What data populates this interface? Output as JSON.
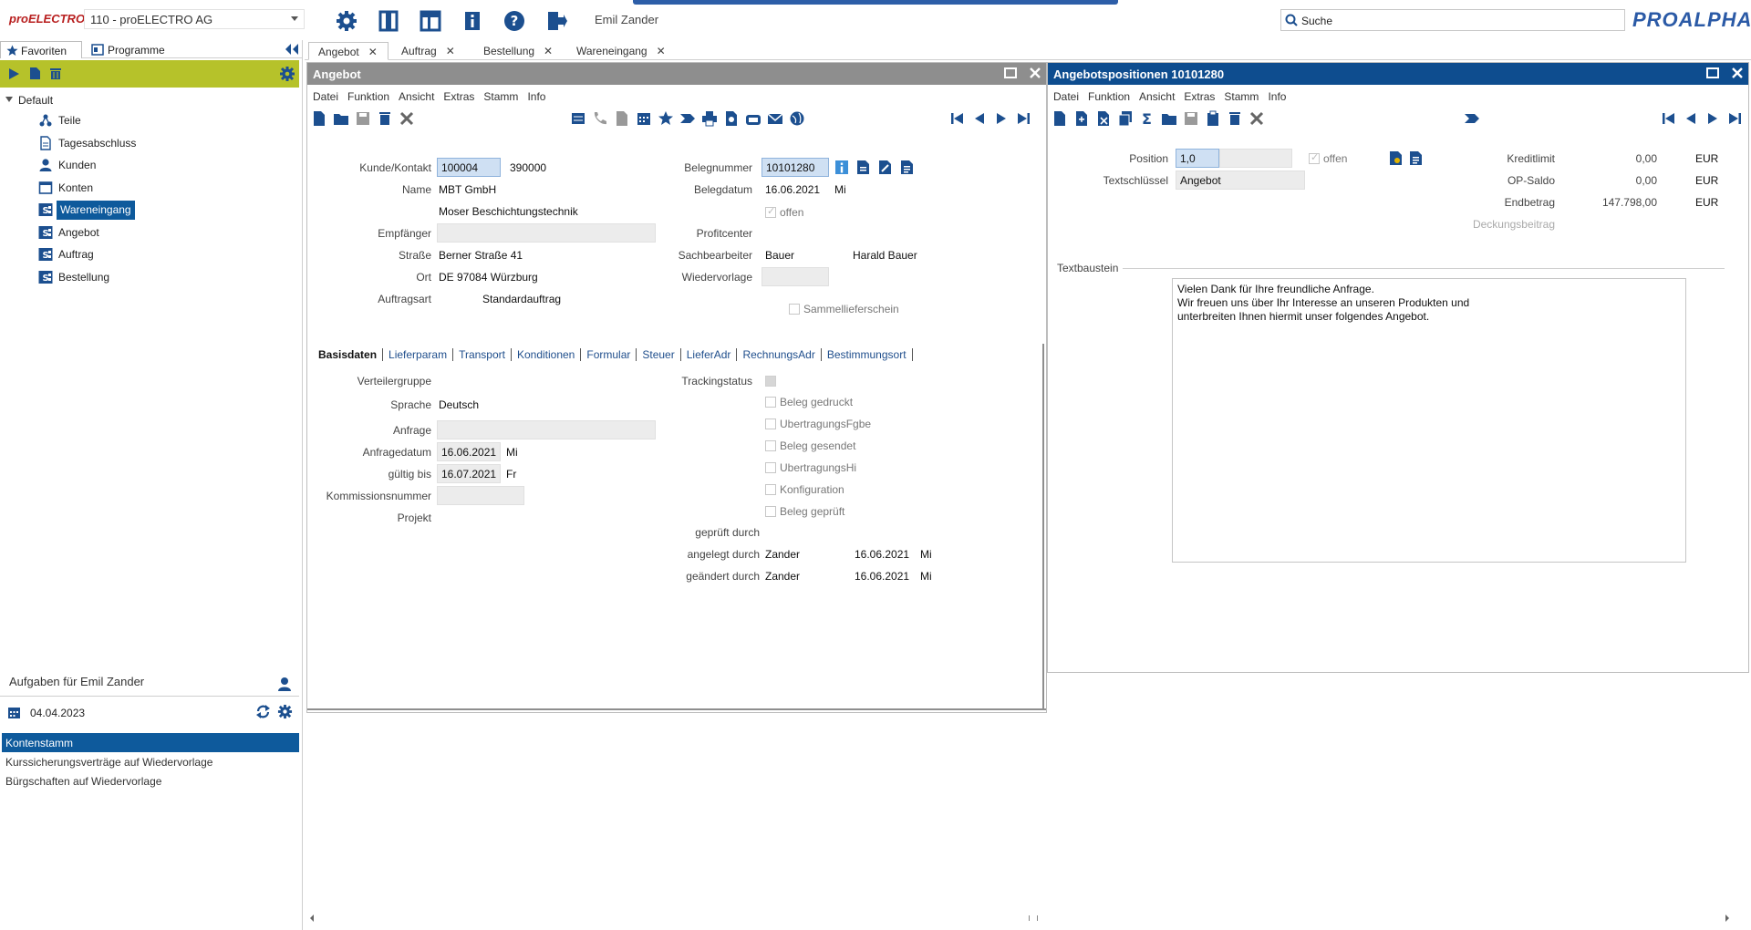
{
  "top": {
    "logo": "proELECTRO",
    "company": "110 - proELECTRO AG",
    "user": "Emil Zander",
    "search_placeholder": "Suche",
    "brand": "PROALPHA",
    "icons": [
      "gear-icon",
      "panel-icon",
      "layout-icon",
      "info-icon",
      "help-icon",
      "logout-icon"
    ]
  },
  "left": {
    "tabs": [
      "Favoriten",
      "Programme"
    ],
    "tree_root": "Default",
    "tree_items": [
      {
        "label": "Teile",
        "icon": "parts-icon"
      },
      {
        "label": "Tagesabschluss",
        "icon": "document-icon"
      },
      {
        "label": "Kunden",
        "icon": "person-icon"
      },
      {
        "label": "Konten",
        "icon": "window-icon"
      },
      {
        "label": "Wareneingang",
        "icon": "program-icon",
        "selected": true
      },
      {
        "label": "Angebot",
        "icon": "program-icon"
      },
      {
        "label": "Auftrag",
        "icon": "program-icon"
      },
      {
        "label": "Bestellung",
        "icon": "program-icon"
      }
    ],
    "tasks_title": "Aufgaben für Emil Zander",
    "task_date": "04.04.2023",
    "tasks": [
      {
        "label": "Kontenstamm",
        "selected": true
      },
      {
        "label": "Kurssicherungsverträge auf Wiedervorlage"
      },
      {
        "label": "Bürgschaften auf Wiedervorlage"
      }
    ]
  },
  "doc_tabs": [
    "Angebot",
    "Auftrag",
    "Bestellung",
    "Wareneingang"
  ],
  "angebot": {
    "title": "Angebot",
    "menu": [
      "Datei",
      "Funktion",
      "Ansicht",
      "Extras",
      "Stamm",
      "Info"
    ],
    "labels": {
      "kunde": "Kunde/Kontakt",
      "name": "Name",
      "empfaenger": "Empfänger",
      "strasse": "Straße",
      "ort": "Ort",
      "auftragsart": "Auftragsart",
      "belegnummer": "Belegnummer",
      "belegdatum": "Belegdatum",
      "profitcenter": "Profitcenter",
      "sachbearbeiter": "Sachbearbeiter",
      "wiedervorlage": "Wiedervorlage",
      "offen": "offen",
      "sammellieferschein": "Sammellieferschein"
    },
    "values": {
      "kunde_nr": "100004",
      "kontakt_nr": "390000",
      "name1": "MBT GmbH",
      "name2": "Moser Beschichtungstechnik",
      "strasse": "Berner Straße 41",
      "ort": "DE 97084 Würzburg",
      "auftragsart": "Standardauftrag",
      "belegnummer": "10101280",
      "belegdatum": "16.06.2021",
      "belegdatum_tag": "Mi",
      "sachbearbeiter_kurz": "Bauer",
      "sachbearbeiter_name": "Harald Bauer"
    },
    "subtabs": [
      "Basisdaten",
      "Lieferparam",
      "Transport",
      "Konditionen",
      "Formular",
      "Steuer",
      "LieferAdr",
      "RechnungsAdr",
      "Bestimmungsort"
    ],
    "basis": {
      "labels": {
        "verteilergruppe": "Verteilergruppe",
        "sprache": "Sprache",
        "anfrage": "Anfrage",
        "anfragedatum": "Anfragedatum",
        "gueltig": "gültig bis",
        "kommission": "Kommissionsnummer",
        "projekt": "Projekt",
        "tracking": "Trackingstatus",
        "geprueft": "geprüft durch",
        "angelegt": "angelegt durch",
        "geaendert": "geändert durch"
      },
      "sprache": "Deutsch",
      "anfragedatum": "16.06.2021",
      "anfragedatum_tag": "Mi",
      "gueltig": "16.07.2021",
      "gueltig_tag": "Fr",
      "checks": [
        "Beleg gedruckt",
        "UbertragungsFgbe",
        "Beleg gesendet",
        "UbertragungsHi",
        "Konfiguration",
        "Beleg geprüft"
      ],
      "angelegt_user": "Zander",
      "angelegt_datum": "16.06.2021",
      "angelegt_tag": "Mi",
      "geaendert_user": "Zander",
      "geaendert_datum": "16.06.2021",
      "geaendert_tag": "Mi"
    }
  },
  "positionen": {
    "title": "Angebotspositionen 10101280",
    "menu": [
      "Datei",
      "Funktion",
      "Ansicht",
      "Extras",
      "Stamm",
      "Info"
    ],
    "labels": {
      "position": "Position",
      "textschluessel": "Textschlüssel",
      "offen": "offen",
      "kreditlimit": "Kreditlimit",
      "op_saldo": "OP-Saldo",
      "endbetrag": "Endbetrag",
      "deckungsbeitrag": "Deckungsbeitrag",
      "textbaustein": "Textbaustein"
    },
    "position": "1,0",
    "textschluessel": "Angebot",
    "kreditlimit": "0,00",
    "op_saldo": "0,00",
    "endbetrag": "147.798,00",
    "currency": "EUR",
    "text_lines": [
      "Vielen Dank für Ihre freundliche Anfrage.",
      "Wir freuen uns über Ihr Interesse an unseren Produkten und",
      "unterbreiten Ihnen hiermit unser folgendes Angebot."
    ]
  },
  "colors": {
    "header_gray": "#8e8e8e",
    "header_blue": "#0e4d8f",
    "accent_green": "#b6c22a",
    "selection": "#0e5a9c"
  }
}
